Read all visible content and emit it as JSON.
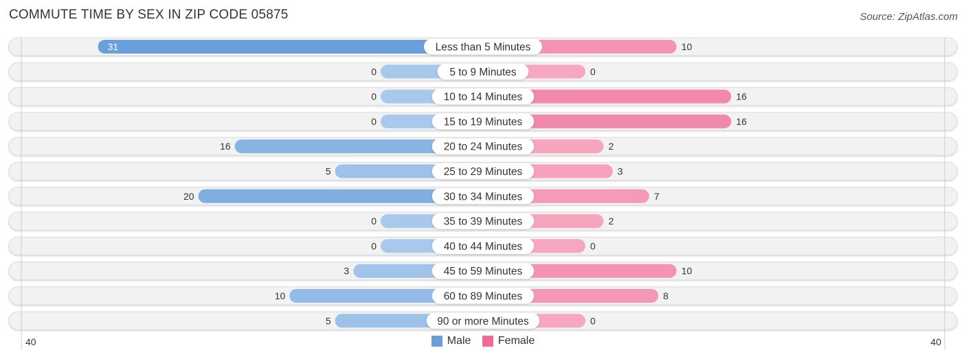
{
  "title": "COMMUTE TIME BY SEX IN ZIP CODE 05875",
  "source": "Source: ZipAtlas.com",
  "colors": {
    "male": "#6a9fdb",
    "male_light": "#a8c8ec",
    "female": "#f06b96",
    "female_light": "#f7a8c0",
    "track": "#f2f2f2"
  },
  "legend": [
    {
      "label": "Male",
      "color": "#6a9fdb"
    },
    {
      "label": "Female",
      "color": "#f06b96"
    }
  ],
  "axis": {
    "left_label": "40",
    "right_label": "40"
  },
  "chart_data": {
    "type": "bar",
    "orientation": "horizontal-diverging",
    "title": "COMMUTE TIME BY SEX IN ZIP CODE 05875",
    "categories": [
      "Less than 5 Minutes",
      "5 to 9 Minutes",
      "10 to 14 Minutes",
      "15 to 19 Minutes",
      "20 to 24 Minutes",
      "25 to 29 Minutes",
      "30 to 34 Minutes",
      "35 to 39 Minutes",
      "40 to 44 Minutes",
      "45 to 59 Minutes",
      "60 to 89 Minutes",
      "90 or more Minutes"
    ],
    "series": [
      {
        "name": "Male",
        "values": [
          31,
          0,
          0,
          0,
          16,
          5,
          20,
          0,
          0,
          3,
          10,
          5
        ]
      },
      {
        "name": "Female",
        "values": [
          10,
          0,
          16,
          16,
          2,
          3,
          7,
          2,
          0,
          10,
          8,
          0
        ]
      }
    ],
    "xlim": [
      40,
      40
    ],
    "legend_position": "bottom-center"
  }
}
